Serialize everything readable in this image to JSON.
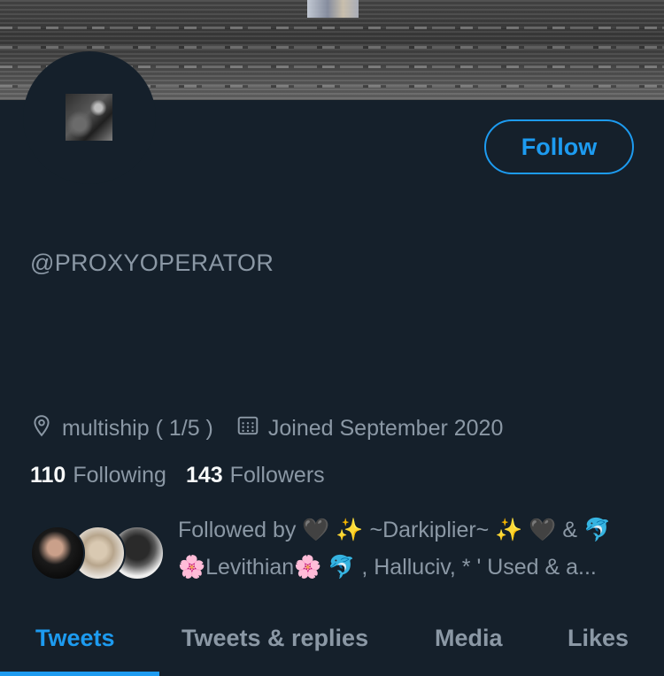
{
  "profile": {
    "handle": "@PROXYOPERATOR",
    "follow_label": "Follow",
    "location": "multiship ( 1/5 )",
    "joined": "Joined September 2020",
    "following_count": "110",
    "following_label": "Following",
    "followers_count": "143",
    "followers_label": "Followers"
  },
  "followed_by": {
    "line1": "Followed by 🖤 ✨ ~Darkiplier~ ✨ 🖤 & 🐬",
    "line2": "🌸Levithian🌸 🐬 , Halluciv, * ' Used & a..."
  },
  "tabs": [
    {
      "label": "Tweets",
      "active": true
    },
    {
      "label": "Tweets & replies",
      "active": false
    },
    {
      "label": "Media",
      "active": false
    },
    {
      "label": "Likes",
      "active": false
    }
  ],
  "colors": {
    "background": "#15202b",
    "accent": "#1d9bf0",
    "secondary_text": "#8b98a5"
  },
  "icons": {
    "location": "location-pin-icon",
    "calendar": "calendar-icon"
  }
}
